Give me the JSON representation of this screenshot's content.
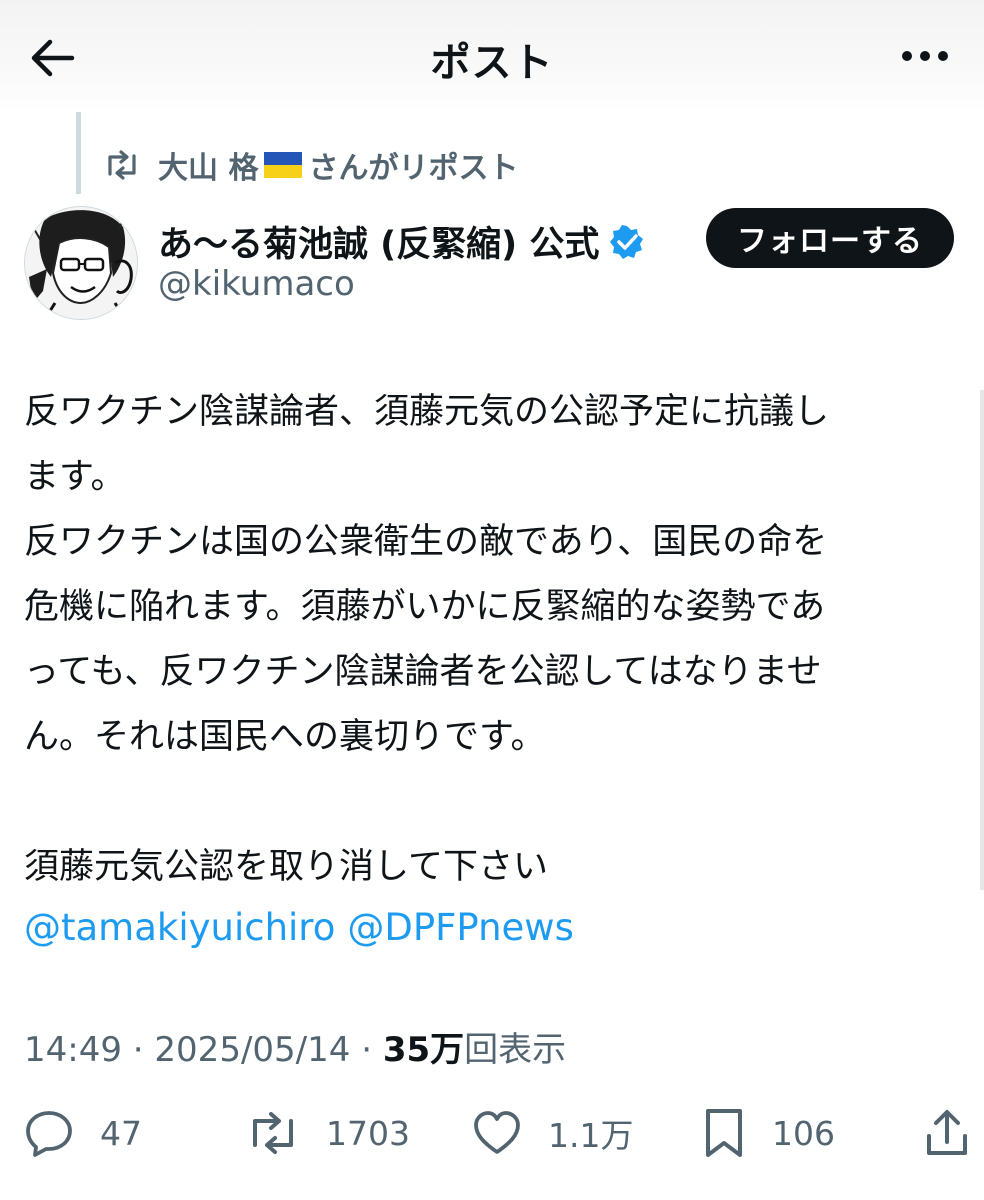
{
  "header": {
    "title": "ポスト"
  },
  "repost": {
    "user": "大山 格",
    "suffix": "さんがリポスト"
  },
  "author": {
    "name": "あ〜る菊池誠 (反緊縮) 公式",
    "handle": "@kikumaco"
  },
  "follow_label": "フォローする",
  "post": {
    "lines": [
      "反ワクチン陰謀論者、須藤元気の公認予定に抗議し",
      "ます。",
      "反ワクチンは国の公衆衛生の敵であり、国民の命を",
      "危機に陥れます。須藤がいかに反緊縮的な姿勢であ",
      "っても、反ワクチン陰謀論者を公認してはなりませ",
      "ん。それは国民への裏切りです。",
      "須藤元気公認を取り消して下さい"
    ],
    "mentions": [
      "@tamakiyuichiro",
      "@DPFPnews"
    ]
  },
  "meta": {
    "time": "14:49",
    "sep": "·",
    "date": "2025/05/14",
    "views_count": "35万",
    "views_label": "回表示"
  },
  "actions": {
    "replies": "47",
    "reposts": "1703",
    "likes": "1.1万",
    "bookmarks": "106"
  },
  "colors": {
    "accent": "#1d9bf0",
    "text": "#0f1419",
    "secondary": "#536471",
    "flag_blue": "#2456b8",
    "flag_yellow": "#f7d117"
  }
}
